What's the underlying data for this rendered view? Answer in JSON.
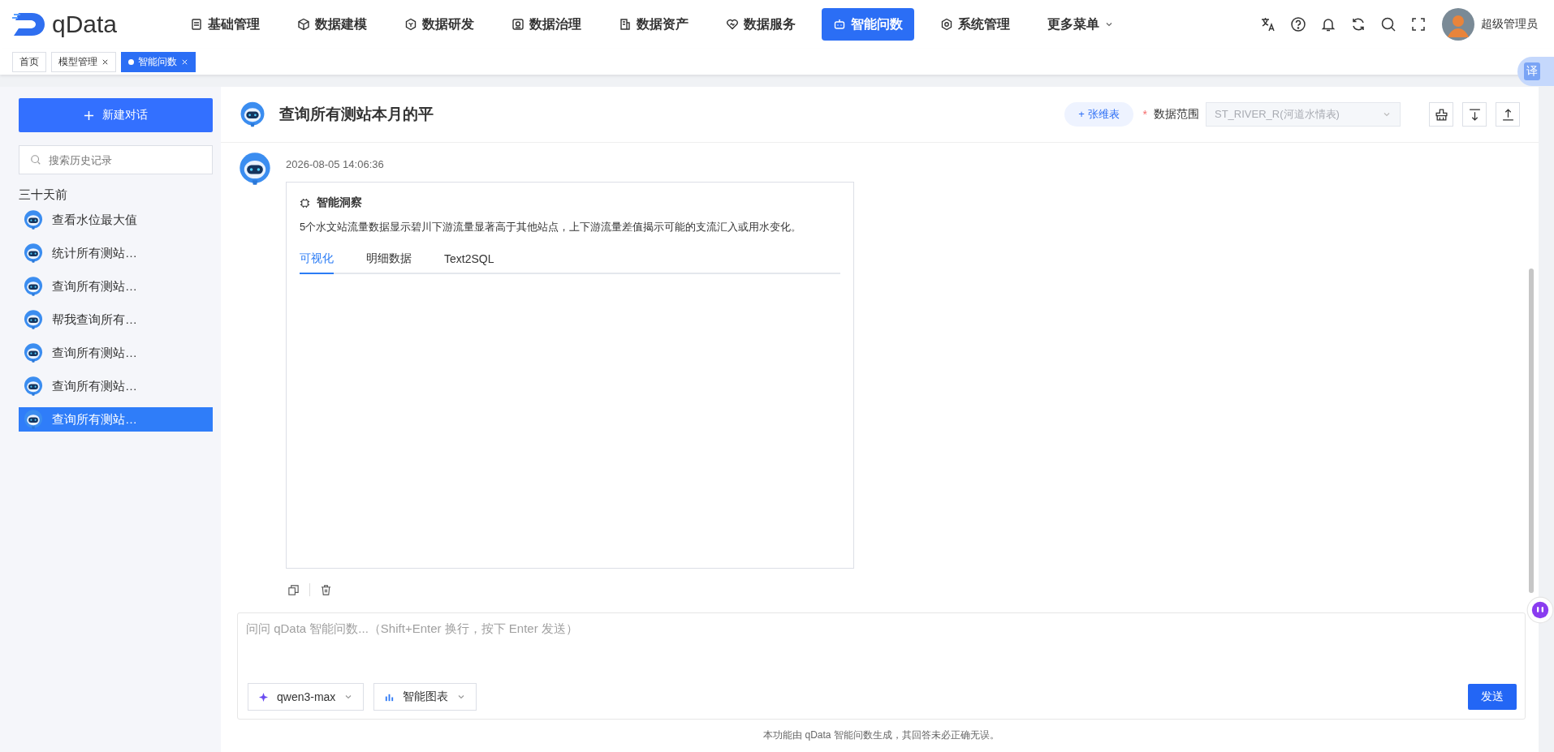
{
  "nav": {
    "logo": "qData",
    "items": [
      {
        "label": "基础管理",
        "kind": "form",
        "selected": false
      },
      {
        "label": "数据建模",
        "kind": "cube",
        "selected": false
      },
      {
        "label": "数据研发",
        "kind": "hex",
        "selected": false
      },
      {
        "label": "数据治理",
        "kind": "frame",
        "selected": false
      },
      {
        "label": "数据资产",
        "kind": "doc",
        "selected": false
      },
      {
        "label": "数据服务",
        "kind": "heart",
        "selected": false
      },
      {
        "label": "智能问数",
        "kind": "robot",
        "selected": true
      },
      {
        "label": "系统管理",
        "kind": "gear",
        "selected": false
      }
    ],
    "more": "更多菜单",
    "user": "超级管理员"
  },
  "tabs": [
    {
      "label": "首页",
      "closable": false,
      "selected": false
    },
    {
      "label": "模型管理",
      "closable": true,
      "selected": false
    },
    {
      "label": "智能问数",
      "closable": true,
      "selected": true
    }
  ],
  "sidebar": {
    "new_button": "新建对话",
    "search_placeholder": "搜索历史记录",
    "group": "三十天前",
    "items": [
      {
        "label": "查看水位最大值",
        "selected": false
      },
      {
        "label": "统计所有测站…",
        "selected": false
      },
      {
        "label": "查询所有测站…",
        "selected": false
      },
      {
        "label": "帮我查询所有…",
        "selected": false
      },
      {
        "label": "查询所有测站…",
        "selected": false
      },
      {
        "label": "查询所有测站…",
        "selected": false
      },
      {
        "label": "查询所有测站…",
        "selected": true
      }
    ]
  },
  "chat": {
    "title": "查询所有测站本月的平",
    "table_button": "+ 张维表",
    "scope_required": "*",
    "scope_label": "数据范围",
    "scope_value": "ST_RIVER_R(河道水情表)",
    "message": {
      "time": "2026-08-05 14:06:36",
      "card_title": "智能洞察",
      "insight": "5个水文站流量数据显示碧川下游流量显著高于其他站点，上下游流量差值揭示可能的支流汇入或用水变化。",
      "tabs": [
        {
          "label": "可视化",
          "selected": true
        },
        {
          "label": "明细数据",
          "selected": false
        },
        {
          "label": "Text2SQL",
          "selected": false
        }
      ]
    },
    "input_placeholder": "问问 qData 智能问数...（Shift+Enter 换行，按下 Enter 发送）",
    "model": "qwen3-max",
    "chart_mode": "智能图表",
    "send": "发送",
    "disclaimer": "本功能由 qData 智能问数生成，其回答未必正确无误。"
  },
  "translate": "译"
}
